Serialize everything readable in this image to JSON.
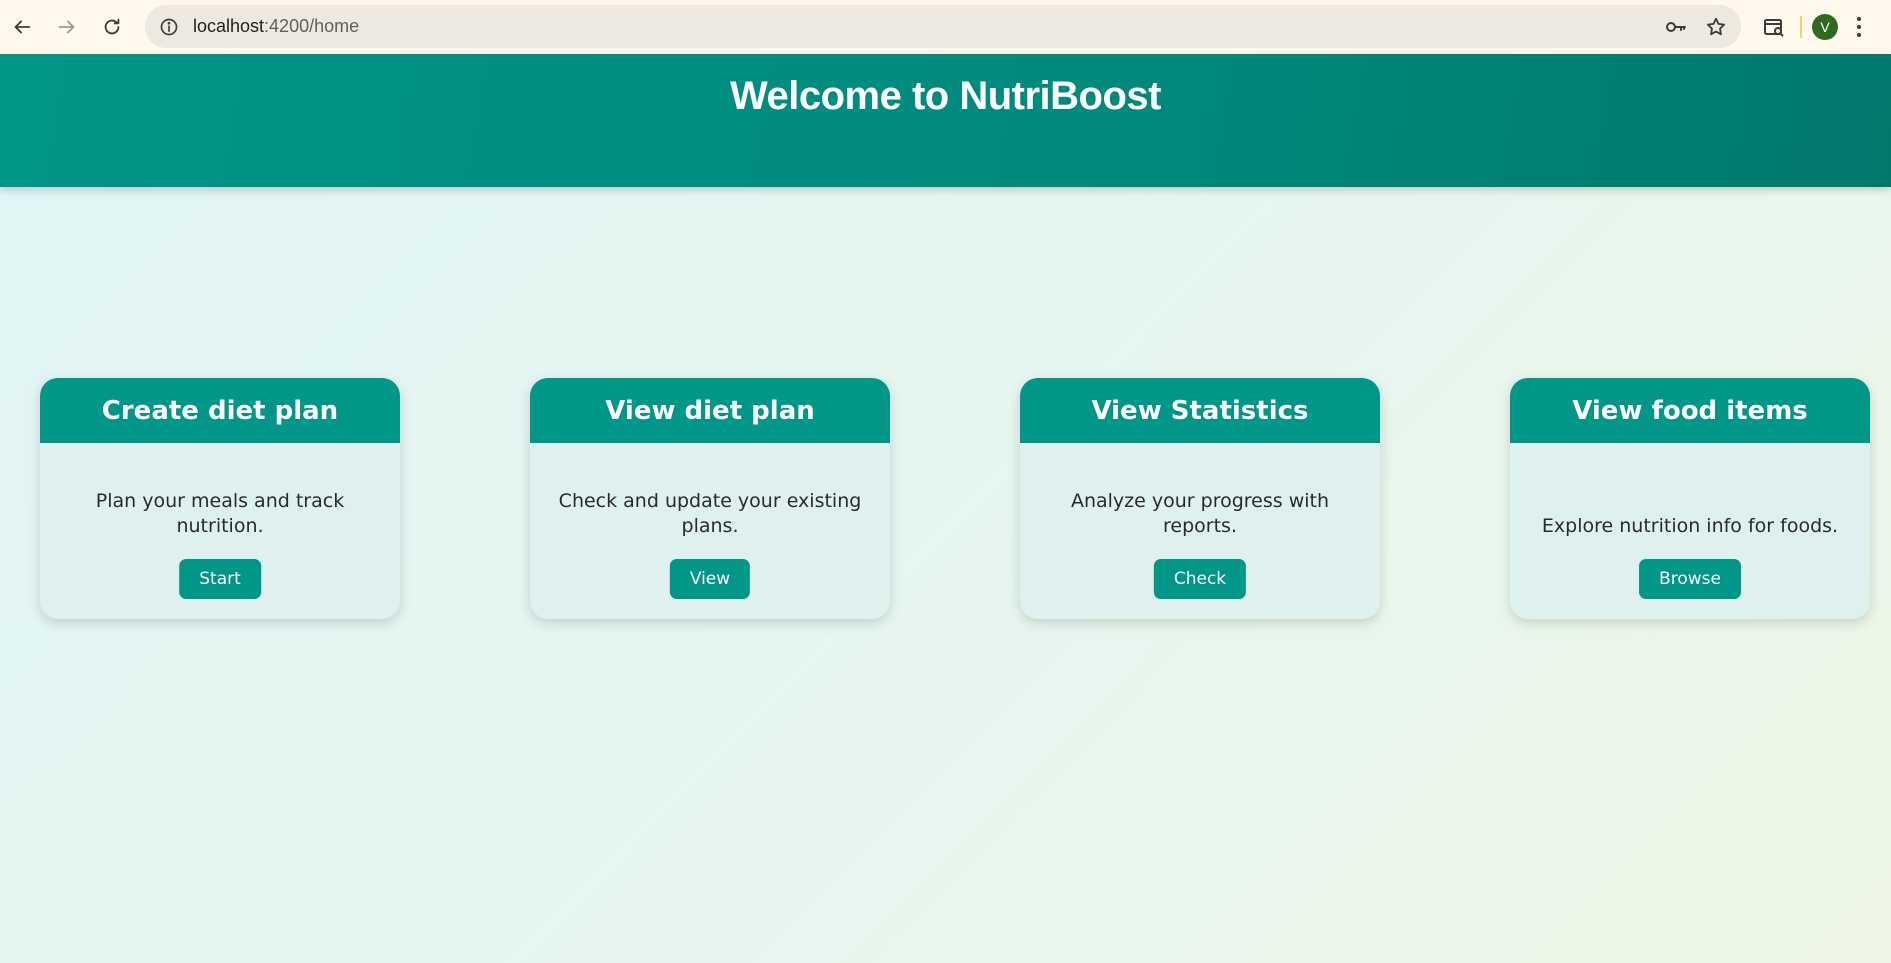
{
  "browser": {
    "url_host": "localhost",
    "url_path": ":4200/home",
    "profile_initial": "V"
  },
  "header": {
    "title": "Welcome to NutriBoost"
  },
  "cards": [
    {
      "title": "Create diet plan",
      "description": "Plan your meals and track nutrition.",
      "button": "Start"
    },
    {
      "title": "View diet plan",
      "description": "Check and update your existing plans.",
      "button": "View"
    },
    {
      "title": "View Statistics",
      "description": "Analyze your progress with reports.",
      "button": "Check"
    },
    {
      "title": "View food items",
      "description": "Explore nutrition info for foods.",
      "button": "Browse"
    }
  ],
  "colors": {
    "primary": "#009688",
    "card_bg": "#dff1ef",
    "header_text": "#ffffff"
  },
  "icons": [
    "back-arrow-icon",
    "forward-arrow-icon",
    "reload-icon",
    "site-info-icon",
    "password-key-icon",
    "bookmark-star-icon",
    "tab-search-icon",
    "menu-kebab-icon"
  ]
}
